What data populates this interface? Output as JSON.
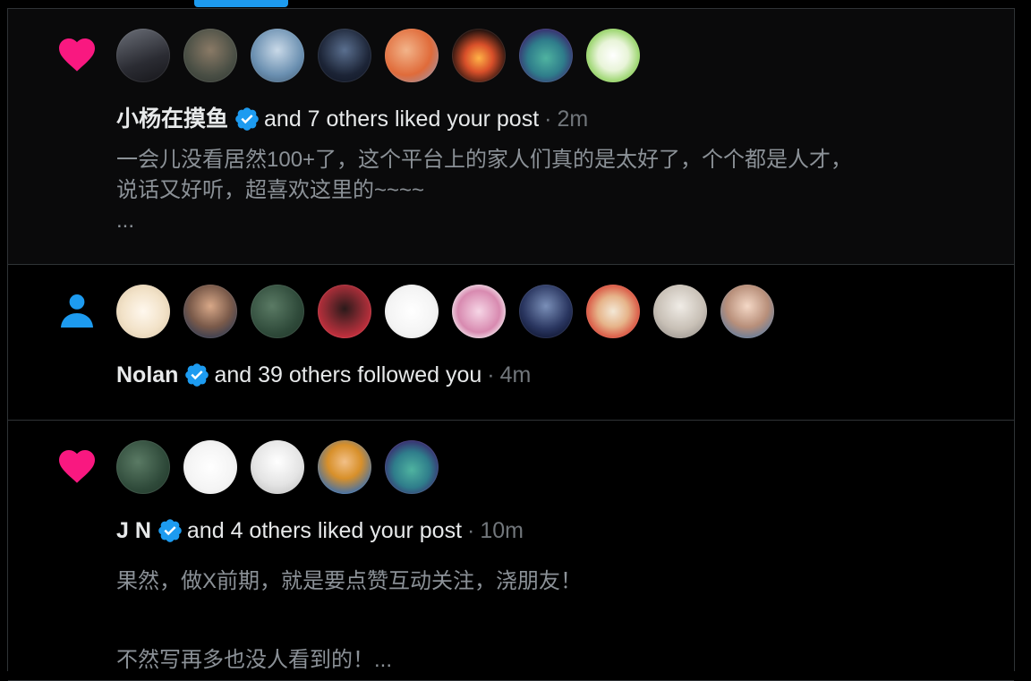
{
  "colors": {
    "accent": "#1d9bf0",
    "like": "#f91880",
    "follow": "#1d9bf0",
    "verified": "#1d9bf0",
    "secondary_text": "#71767b",
    "divider": "#2f3336"
  },
  "notifications": [
    {
      "type": "like",
      "icon": "heart-icon",
      "name": "小杨在摸鱼",
      "verified": true,
      "action": "and 7 others liked your post",
      "separator": "·",
      "time": "2m",
      "body": "一会儿没看居然100+了，这个平台上的家人们真的是太好了，个个都是人才，\n说话又好听，超喜欢这里的~~~~\n...",
      "avatars": [
        {
          "name": "avatar-man-at-desk",
          "bg": "linear-gradient(160deg,#6b6f78,#2b2c33 60%,#16161a)"
        },
        {
          "name": "avatar-bald-man",
          "bg": "radial-gradient(circle at 50% 40%,#8a7a66,#4a4f45 60%,#2e3530)"
        },
        {
          "name": "avatar-anime-girl-blue",
          "bg": "radial-gradient(circle at 50% 40%,#c9d9e8,#6a8fb0 60%,#3e566d)"
        },
        {
          "name": "avatar-anime-man-dark",
          "bg": "radial-gradient(circle at 50% 40%,#5a6f8f,#1c2436 60%,#0d1220)"
        },
        {
          "name": "avatar-orange-hair-girl",
          "bg": "radial-gradient(circle at 40% 40%,#f2b48a,#e06b3a 55%,#8aa0c8)"
        },
        {
          "name": "avatar-campfire",
          "bg": "radial-gradient(circle at 50% 55%,#ffb347,#d9502a 35%,#2a1510 70%,#0b0604)"
        },
        {
          "name": "avatar-green-dinosaur",
          "bg": "radial-gradient(circle at 50% 55%,#4fb3a0,#2f7d8b 45%,#3b1f6b 80%)"
        },
        {
          "name": "avatar-snoopy-coins",
          "bg": "radial-gradient(circle at 50% 50%,#ffffff,#e8f4d8 40%,#8ccf5a 75%)"
        }
      ]
    },
    {
      "type": "follow",
      "icon": "person-icon",
      "name": "Nolan",
      "verified": true,
      "action": "and 39 others followed you",
      "separator": "·",
      "time": "4m",
      "body": "",
      "avatars": [
        {
          "name": "avatar-cartoon-cow",
          "bg": "radial-gradient(circle at 50% 50%,#fff8ee,#f2e2c8 55%,#d8c4a4)"
        },
        {
          "name": "avatar-man-suit",
          "bg": "radial-gradient(circle at 50% 40%,#d8a888,#7a5a4a 50%,#3a3f52 80%)"
        },
        {
          "name": "avatar-green-texture",
          "bg": "radial-gradient(circle at 40% 40%,#5a7a64,#2f4a3a 60%,#1e3326)"
        },
        {
          "name": "avatar-red-hood",
          "bg": "radial-gradient(circle at 50% 45%,#2a1a1a,#8a2a32 45%,#c8303e 75%)"
        },
        {
          "name": "avatar-doodle-face",
          "bg": "radial-gradient(circle at 50% 50%,#ffffff,#f4f4f4 60%,#dcdcdc)"
        },
        {
          "name": "avatar-pink-anime",
          "bg": "radial-gradient(circle at 50% 50%,#f6d6e6,#d88ab0 55%,#f4eef2 80%)"
        },
        {
          "name": "avatar-night-portrait",
          "bg": "radial-gradient(circle at 50% 40%,#7a8fb8,#2a3660 55%,#0e1430 85%)"
        },
        {
          "name": "avatar-red-penguin",
          "bg": "radial-gradient(circle at 50% 50%,#f3e8d6,#e6b48a 40%,#d84a3a 75%)"
        },
        {
          "name": "avatar-white-hair",
          "bg": "radial-gradient(circle at 50% 40%,#f0ece6,#c8c0b6 55%,#8a8480)"
        },
        {
          "name": "avatar-woman-lake",
          "bg": "radial-gradient(circle at 50% 40%,#f4d8c6,#b88f7a 50%,#5a7aa0 85%)"
        }
      ]
    },
    {
      "type": "like",
      "icon": "heart-icon",
      "name": "J N",
      "verified": true,
      "action": "and 4 others liked your post",
      "separator": "·",
      "time": "10m",
      "body": "果然，做X前期，就是要点赞互动关注，浇朋友！\n\n不然写再多也没人看到的！...",
      "avatars": [
        {
          "name": "avatar-green-texture",
          "bg": "radial-gradient(circle at 40% 40%,#5a7a64,#2f4a3a 60%,#1e3326)"
        },
        {
          "name": "avatar-doodle-face",
          "bg": "radial-gradient(circle at 50% 50%,#ffffff,#f4f4f4 60%,#dcdcdc)"
        },
        {
          "name": "avatar-sketch-anime",
          "bg": "radial-gradient(circle at 50% 40%,#ffffff,#e4e4e4 55%,#b8b8b8)"
        },
        {
          "name": "avatar-straw-hat",
          "bg": "radial-gradient(circle at 50% 40%,#f2c088,#d8902a 40%,#3a6fb0 80%)"
        },
        {
          "name": "avatar-green-dinosaur",
          "bg": "radial-gradient(circle at 50% 55%,#4fb3a0,#2f7d8b 45%,#3b1f6b 80%)"
        }
      ]
    }
  ]
}
